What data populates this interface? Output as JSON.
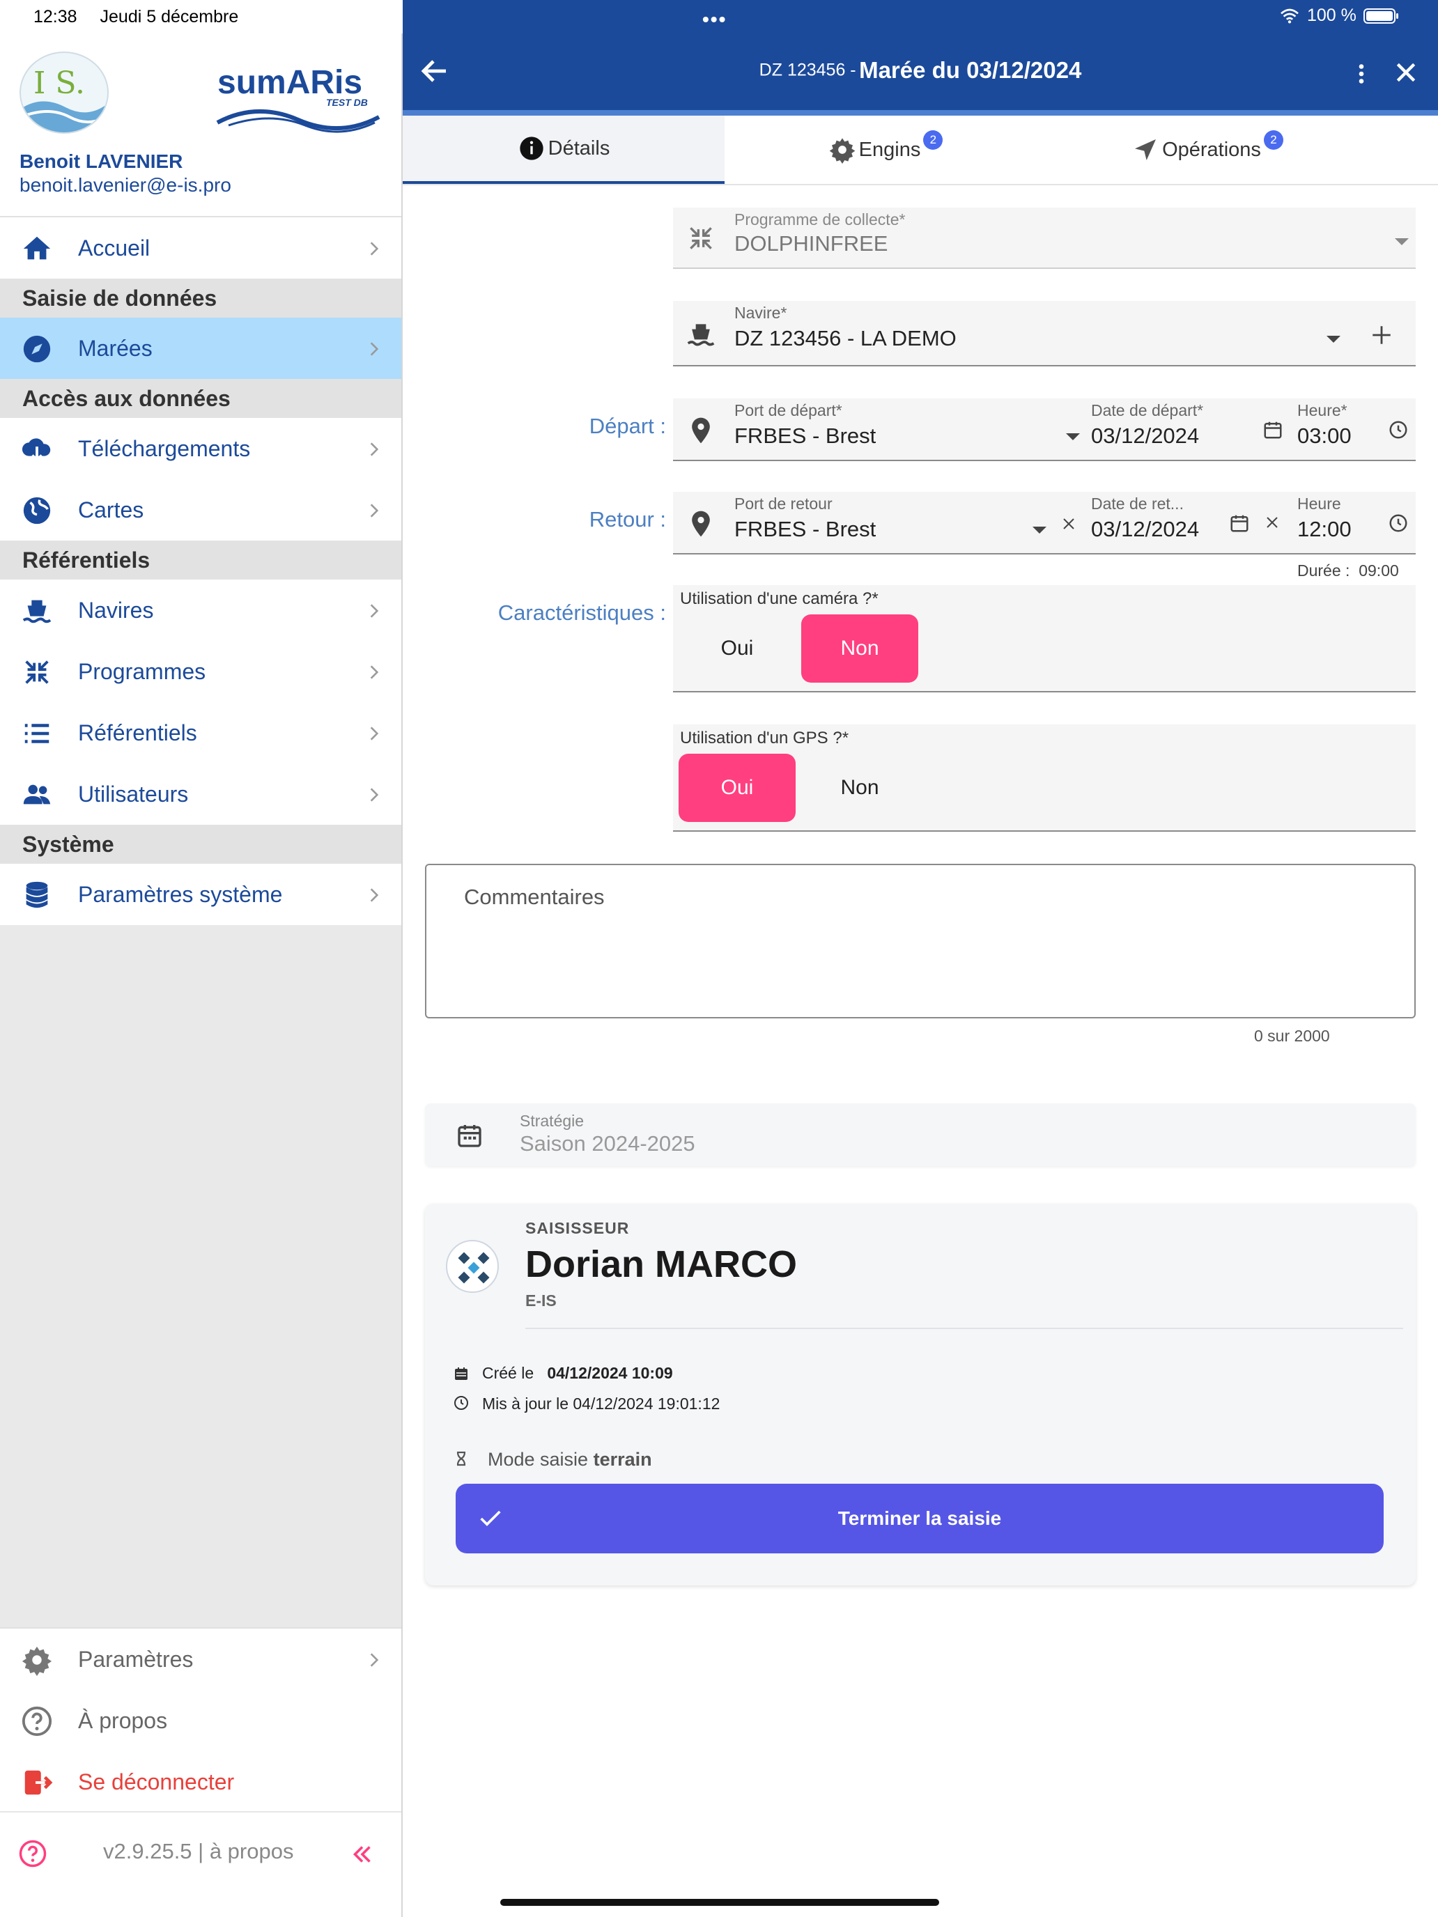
{
  "status_bar": {
    "time": "12:38",
    "date": "Jeudi 5 décembre",
    "battery": "100 %"
  },
  "sidebar": {
    "user_name": "Benoit LAVENIER",
    "user_email": "benoit.lavenier@e-is.pro",
    "logo_is_text": "I S.",
    "logo_sumaris_text": "sumARis",
    "logo_sumaris_sub": "TEST DB",
    "items": {
      "home": "Accueil",
      "section_input": "Saisie de données",
      "trips": "Marées",
      "section_access": "Accès aux données",
      "downloads": "Téléchargements",
      "maps": "Cartes",
      "section_ref": "Référentiels",
      "vessels": "Navires",
      "programs": "Programmes",
      "referentials": "Référentiels",
      "users": "Utilisateurs",
      "section_system": "Système",
      "system_params": "Paramètres système"
    },
    "bottom": {
      "settings": "Paramètres",
      "about": "À propos",
      "logout": "Se déconnecter",
      "version": "v2.9.25.5 | à propos"
    }
  },
  "header": {
    "title_prefix": "DZ 123456 -",
    "title": "Marée du 03/12/2024"
  },
  "tabs": [
    {
      "label": "Détails",
      "badge": ""
    },
    {
      "label": "Engins",
      "badge": "2"
    },
    {
      "label": "Opérations",
      "badge": "2"
    }
  ],
  "form": {
    "program_label": "Programme de collecte*",
    "program_value": "DOLPHINFREE",
    "vessel_label": "Navire*",
    "vessel_value": "DZ 123456 - LA DEMO",
    "departure_row": "Départ :",
    "departure_port_label": "Port de départ*",
    "departure_port_value": "FRBES - Brest",
    "departure_date_label": "Date de départ*",
    "departure_date_value": "03/12/2024",
    "departure_time_label": "Heure*",
    "departure_time_value": "03:00",
    "return_row": "Retour :",
    "return_port_label": "Port de retour",
    "return_port_value": "FRBES - Brest",
    "return_date_label": "Date de ret...",
    "return_date_value": "03/12/2024",
    "return_time_label": "Heure",
    "return_time_value": "12:00",
    "duration_label": "Durée :",
    "duration_value": "09:00",
    "features_row": "Caractéristiques :",
    "camera_label": "Utilisation d'une caméra ?*",
    "gps_label": "Utilisation d'un GPS ?*",
    "yes": "Oui",
    "no": "Non",
    "comments_placeholder": "Commentaires",
    "comments_counter": "0 sur 2000",
    "strategy_label": "Stratégie",
    "strategy_value": "Saison 2024-2025"
  },
  "card": {
    "role": "SAISISSEUR",
    "name": "Dorian MARCO",
    "org": "E-IS",
    "created_prefix": "Créé le",
    "created_value": "04/12/2024 10:09",
    "updated": "Mis à jour le 04/12/2024 19:01:12",
    "mode_prefix": "Mode saisie",
    "mode_value": "terrain",
    "finish_button": "Terminer la saisie"
  },
  "colors": {
    "primary": "#1c4a9a",
    "accent": "#ff3f7f",
    "finish": "#5656e6",
    "active_nav": "#aedcfc"
  }
}
